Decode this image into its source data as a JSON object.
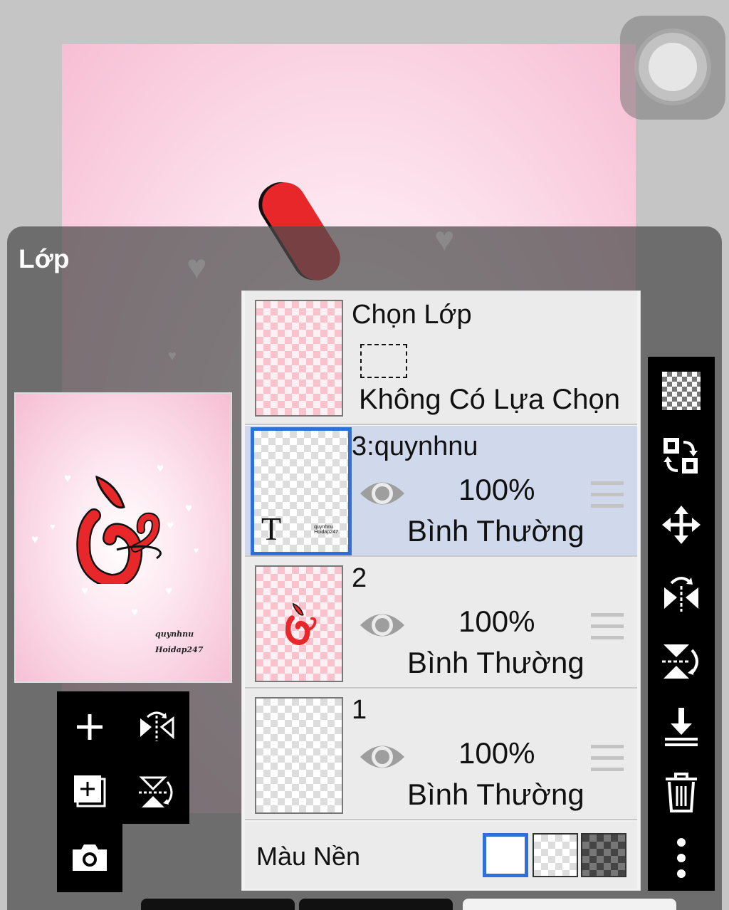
{
  "panel": {
    "title": "Lớp"
  },
  "preview": {
    "watermark_line1": "quynhnu",
    "watermark_line2": "Hoidap247"
  },
  "selection_row": {
    "title": "Chọn Lớp",
    "status": "Không Có Lựa Chọn"
  },
  "layers": [
    {
      "name": "3:quynhnu",
      "opacity": "100%",
      "blend": "Bình Thường",
      "selected": true,
      "thumb_glyph": "T"
    },
    {
      "name": "2",
      "opacity": "100%",
      "blend": "Bình Thường",
      "selected": false
    },
    {
      "name": "1",
      "opacity": "100%",
      "blend": "Bình Thường",
      "selected": false
    }
  ],
  "background": {
    "label": "Màu Nền",
    "options": [
      "white",
      "transparent",
      "dark"
    ],
    "selected": "white"
  },
  "colors": {
    "accent": "#2f6fd8",
    "selected_row": "#cfd9eb",
    "toolbar": "#000000",
    "ink_red": "#e8272b"
  },
  "icons": {
    "left_toolbar": [
      "add-layer-icon",
      "flip-horizontal-icon",
      "add-folder-icon",
      "flip-vertical-icon",
      "camera-icon"
    ],
    "right_toolbar": [
      "transparency-icon",
      "swap-layer-icon",
      "move-icon",
      "flip-horizontal-icon",
      "flip-vertical-icon",
      "merge-down-icon",
      "trash-icon",
      "more-icon"
    ]
  }
}
